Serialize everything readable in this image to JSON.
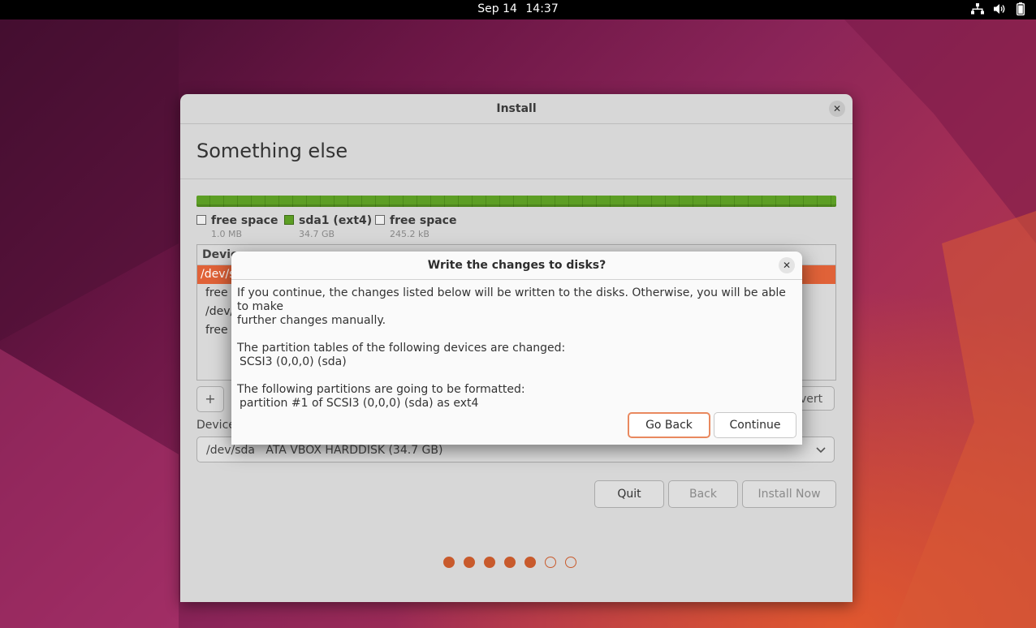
{
  "topbar": {
    "date": "Sep 14",
    "time": "14:37",
    "icons": [
      "network-icon",
      "volume-icon",
      "battery-icon"
    ]
  },
  "window": {
    "title": "Install",
    "heading": "Something else",
    "legend": [
      {
        "name": "free space",
        "size": "1.0 MB",
        "color": "#eeeeee"
      },
      {
        "name": "sda1 (ext4)",
        "size": "34.7 GB",
        "color": "#5c9e24"
      },
      {
        "name": "free space",
        "size": "245.2 kB",
        "color": "#eeeeee"
      }
    ],
    "table": {
      "header": "Devic",
      "rows": [
        "/dev/s",
        "free",
        "/dev/",
        "free"
      ]
    },
    "add_label": "+",
    "revert_label": "vert",
    "device_label": "Device",
    "device_select": {
      "path": "/dev/sda",
      "name": "ATA VBOX HARDDISK (34.7 GB)"
    },
    "buttons": {
      "quit": "Quit",
      "back": "Back",
      "install": "Install Now"
    },
    "progress": {
      "total": 7,
      "completed": 5
    }
  },
  "dialog": {
    "title": "Write the changes to disks?",
    "line1": "If you continue, the changes listed below will be written to the disks. Otherwise, you will be able to make",
    "line2": "further changes manually.",
    "tables_heading": "The partition tables of the following devices are changed:",
    "tables_item": "SCSI3 (0,0,0) (sda)",
    "format_heading": "The following partitions are going to be formatted:",
    "format_item": "partition #1 of SCSI3 (0,0,0) (sda) as ext4",
    "go_back": "Go Back",
    "continue": "Continue"
  },
  "colors": {
    "accent": "#e06238",
    "partition": "#5c9e24"
  }
}
